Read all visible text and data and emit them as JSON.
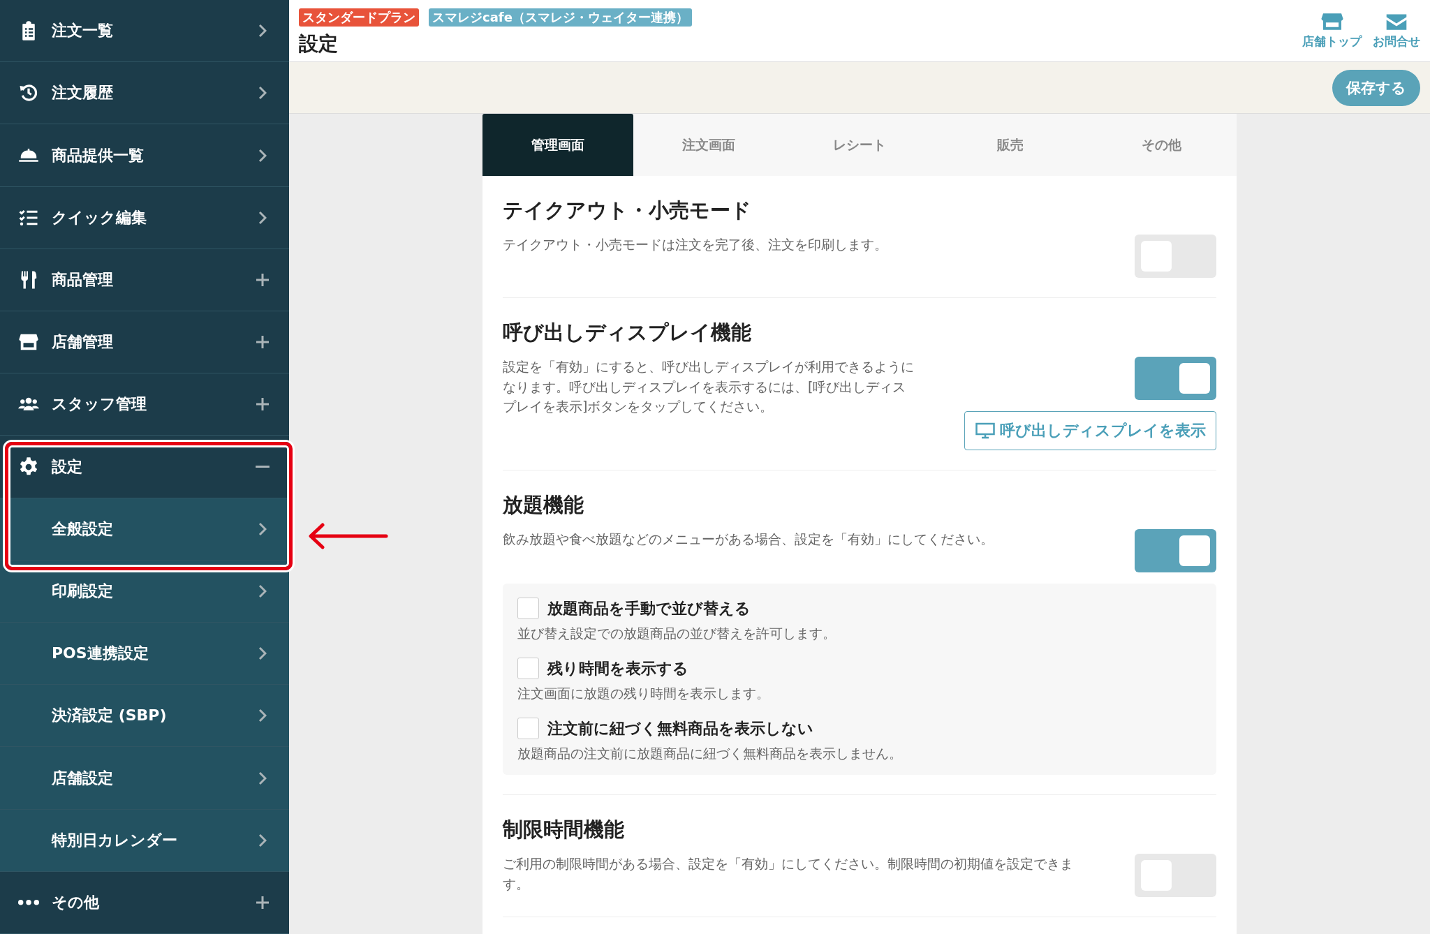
{
  "sidebar": {
    "items": [
      {
        "label": "注文一覧",
        "kind": "link"
      },
      {
        "label": "注文履歴",
        "kind": "link"
      },
      {
        "label": "商品提供一覧",
        "kind": "link"
      },
      {
        "label": "クイック編集",
        "kind": "link"
      },
      {
        "label": "商品管理",
        "kind": "group",
        "expanded": false
      },
      {
        "label": "店舗管理",
        "kind": "group",
        "expanded": false
      },
      {
        "label": "スタッフ管理",
        "kind": "group",
        "expanded": false
      },
      {
        "label": "設定",
        "kind": "group",
        "expanded": true,
        "children": [
          {
            "label": "全般設定"
          },
          {
            "label": "印刷設定"
          },
          {
            "label": "POS連携設定"
          },
          {
            "label": "決済設定 (SBP)"
          },
          {
            "label": "店舗設定"
          },
          {
            "label": "特別日カレンダー"
          }
        ]
      },
      {
        "label": "その他",
        "kind": "group",
        "expanded": false
      }
    ]
  },
  "header": {
    "badges": [
      {
        "label": "スタンダードプラン",
        "color": "#e8533a"
      },
      {
        "label": "スマレジcafe（スマレジ・ウェイター連携）",
        "color": "#6ab0c6"
      }
    ],
    "title": "設定",
    "links": [
      "店舗トップ",
      "お問合せ"
    ]
  },
  "toolbar": {
    "save_button": "保存する"
  },
  "tabs": [
    {
      "label": "管理画面",
      "selected": true
    },
    {
      "label": "注文画面",
      "selected": false
    },
    {
      "label": "レシート",
      "selected": false
    },
    {
      "label": "販売",
      "selected": false
    },
    {
      "label": "その他",
      "selected": false
    }
  ],
  "sections": [
    {
      "title": "テイクアウト・小売モード",
      "description": "テイクアウト・小売モードは注文を完了後、注文を印刷します。",
      "on": false
    },
    {
      "title": "呼び出しディスプレイ機能",
      "description": "設定を「有効」にすると、呼び出しディスプレイが利用できるようになります。呼び出しディスプレイを表示するには、[呼び出しディスプレイを表示]ボタンをタップしてください。",
      "on": true,
      "button": "呼び出しディスプレイを表示"
    },
    {
      "title": "放題機能",
      "description": "飲み放題や食べ放題などのメニューがある場合、設定を「有効」にしてください。",
      "on": true,
      "options": [
        {
          "label": "放題商品を手動で並び替える",
          "description": "並び替え設定での放題商品の並び替えを許可します。",
          "checked": false
        },
        {
          "label": "残り時間を表示する",
          "description": "注文画面に放題の残り時間を表示します。",
          "checked": false
        },
        {
          "label": "注文前に紐づく無料商品を表示しない",
          "description": "放題商品の注文前に放題商品に紐づく無料商品を表示しません。",
          "checked": false
        }
      ]
    },
    {
      "title": "制限時間機能",
      "description": "ご利用の制限時間がある場合、設定を「有効」にしてください。制限時間の初期値を設定できます。",
      "on": false
    }
  ]
}
